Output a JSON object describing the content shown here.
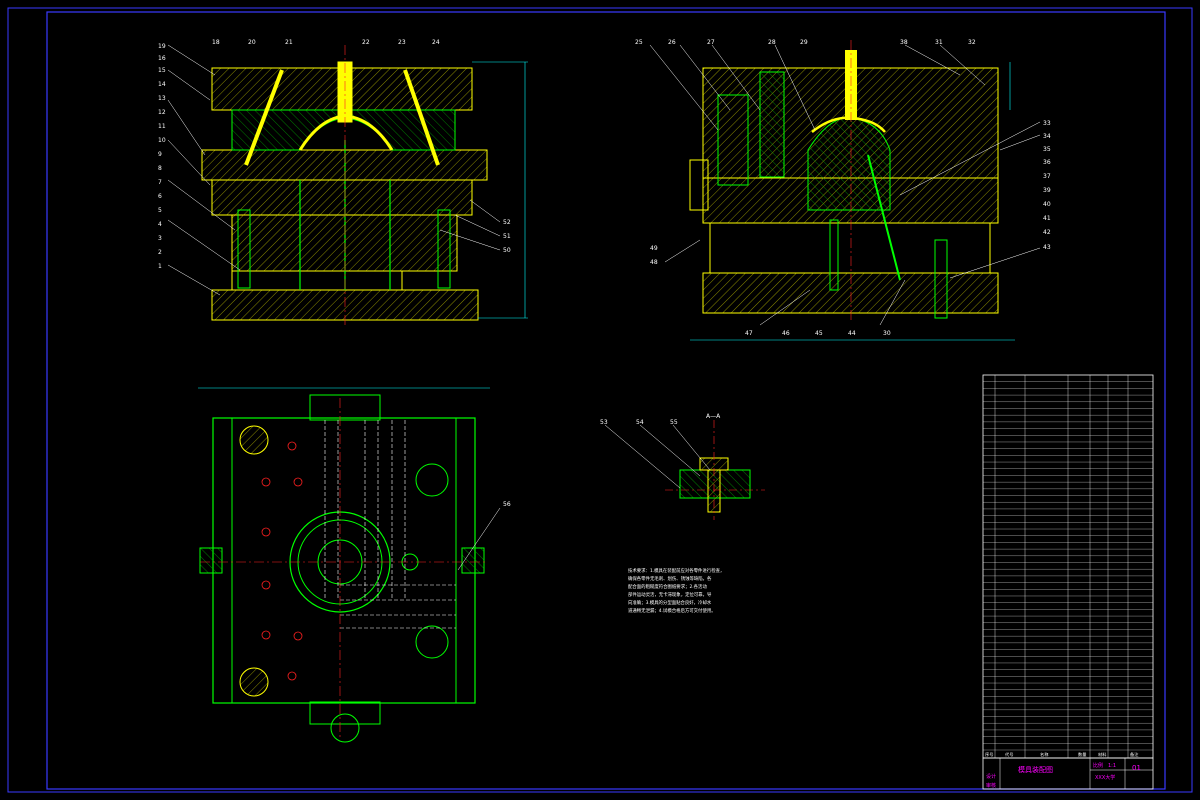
{
  "drawing": {
    "title_block": {
      "drawing_name": "模具装配图",
      "sheet_no": "01",
      "scale_label": "比例",
      "scale_value": "1:1",
      "school": "XXX大学",
      "designer_label": "设计",
      "checker_label": "审核"
    },
    "bom_header": [
      "序号",
      "代号",
      "名称",
      "数量",
      "材料",
      "备注"
    ],
    "notes": [
      "技术要求：1.模具在装配前应对各零件进行检查，",
      "确保各零件无毛刺、划伤、锈蚀等缺陷，各",
      "配合面的粗糙度符合图纸要求；2.各活动",
      "部件运动灵活，无卡滞现象，定位可靠，导",
      "向准确；3.模具的分型面贴合良好，冷却水",
      "道通畅无泄漏；4.试模合格后方可交付使用。"
    ],
    "view_labels": {
      "section_a": "A—A"
    },
    "balloons_front": [
      "1",
      "2",
      "3",
      "4",
      "5",
      "6",
      "7",
      "8",
      "9",
      "10",
      "11",
      "12",
      "13",
      "14",
      "15",
      "16",
      "18",
      "19",
      "20",
      "21",
      "22",
      "23",
      "24",
      "50",
      "51",
      "52"
    ],
    "balloons_side": [
      "25",
      "26",
      "27",
      "28",
      "29",
      "30",
      "31",
      "32",
      "33",
      "34",
      "35",
      "36",
      "37",
      "38",
      "39",
      "40",
      "41",
      "42",
      "43",
      "44",
      "45",
      "46",
      "47",
      "48",
      "49"
    ],
    "balloons_detail": [
      "53",
      "54",
      "55",
      "56"
    ],
    "colors": {
      "frame": "#3a3aff",
      "outline": "#ffff00",
      "hatch": "#00ff00",
      "center": "#ff2020",
      "dim": "#ff00ff",
      "cyan": "#00ffff",
      "text": "#ffffff"
    }
  }
}
